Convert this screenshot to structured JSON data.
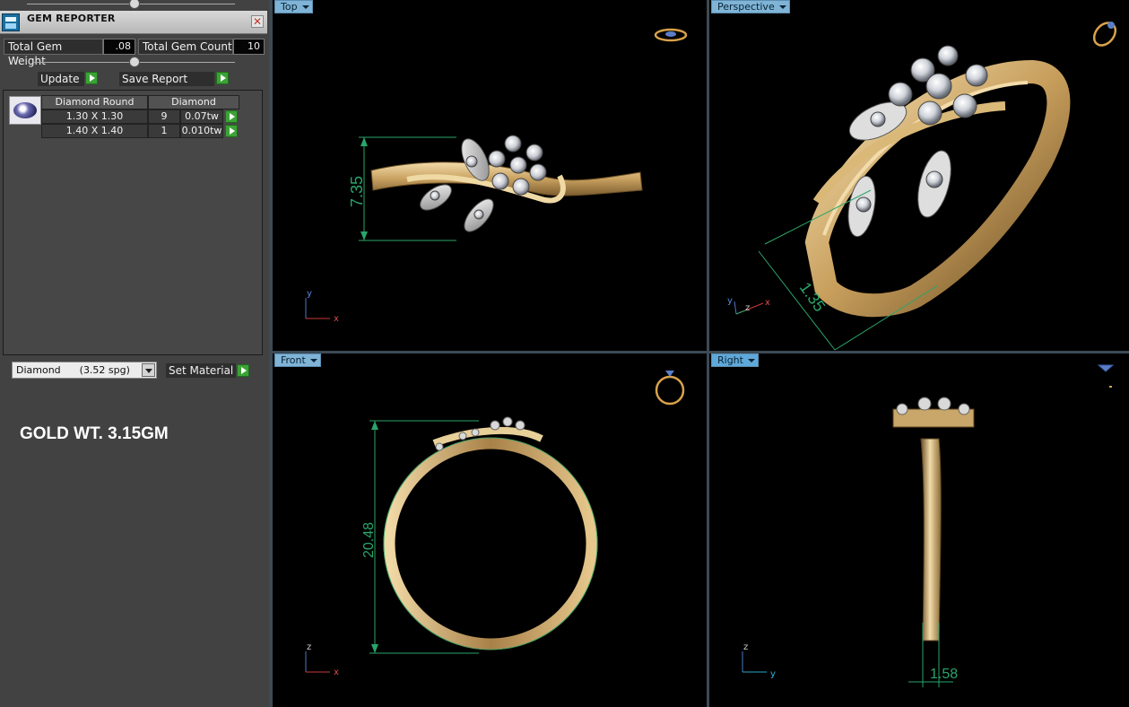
{
  "gem_reporter": {
    "title": "GEM REPORTER",
    "close_glyph": "✕",
    "total_gem_weight_label": "Total Gem Weight",
    "total_gem_weight_value": ".08",
    "total_gem_count_label": "Total Gem Count",
    "total_gem_count_value": "10",
    "update_label": "Update",
    "save_report_label": "Save Report",
    "table": {
      "headers": [
        "Diamond Round",
        "Diamond"
      ],
      "rows": [
        {
          "size": "1.30 X 1.30",
          "count": "9",
          "weight": "0.07tw"
        },
        {
          "size": "1.40 X 1.40",
          "count": "1",
          "weight": "0.010tw"
        }
      ]
    },
    "material_select_value": "Diamond      (3.52 spg)",
    "set_material_label": "Set Material",
    "gold_weight_note": "GOLD WT. 3.15GM"
  },
  "viewports": {
    "top": {
      "label": "Top",
      "dimension": "7.35",
      "axis_v": "y",
      "axis_h": "x"
    },
    "perspective": {
      "label": "Perspective",
      "dimension": "1.35",
      "axis_v": "y",
      "axis_h": "x",
      "axis_z": "z"
    },
    "front": {
      "label": "Front",
      "dimension": "20.48",
      "axis_v": "z",
      "axis_h": "x"
    },
    "right": {
      "label": "Right",
      "dimension": "1.58",
      "axis_v": "z",
      "axis_h": "y"
    }
  },
  "colors": {
    "panel_bg": "#424242",
    "tab_bg": "#7fb4d6",
    "active_tab_bg": "#5fa9da",
    "dimension_green": "#2aa56a",
    "gold": "#d8b67a",
    "go_button": "#3ba335"
  }
}
